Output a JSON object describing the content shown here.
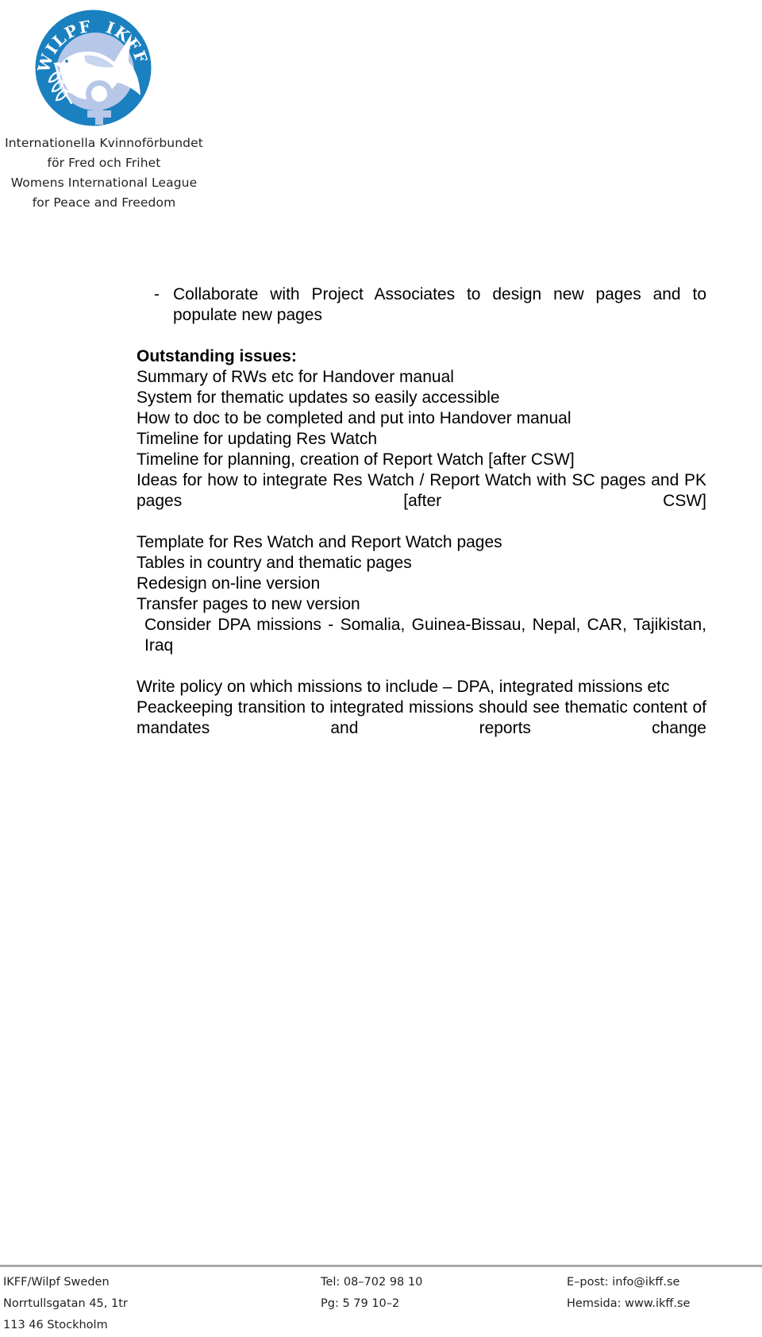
{
  "letterhead": {
    "logo": {
      "icon": "wilpf-ikff-dove-logo",
      "arc_text_left": "WILPF",
      "arc_text_right": "IKFF",
      "circle_color": "#1a80bf",
      "dove_color": "#ffffff",
      "accent_color": "#b7c7e8"
    },
    "org_lines": [
      "Internationella Kvinnoförbundet",
      "för Fred och Frihet",
      "Womens International League",
      "for Peace and Freedom"
    ]
  },
  "body": {
    "bullet": {
      "marker": "-",
      "text": "Collaborate with Project Associates to design new pages and to populate new pages"
    },
    "heading": "Outstanding issues:",
    "issues": [
      "Summary of RWs etc for Handover manual",
      "System for thematic updates so easily accessible",
      "How to doc to be completed and put into Handover manual",
      "Timeline for updating Res Watch",
      "Timeline for planning, creation of Report Watch [after CSW]",
      "Ideas for how to integrate Res Watch / Report Watch with SC pages and PK pages [after CSW]",
      "Template for Res Watch and Report Watch pages",
      "Tables in country and thematic pages",
      "Redesign on-line version",
      "Transfer pages to new version",
      "Consider DPA missions - Somalia, Guinea-Bissau, Nepal, CAR, Tajikistan, Iraq"
    ],
    "paragraphs": [
      "Write policy on which missions to include – DPA, integrated missions etc",
      "Peackeeping transition to integrated missions should see thematic content of mandates and reports change"
    ]
  },
  "footer": {
    "column1": [
      "IKFF/Wilpf Sweden",
      "Norrtullsgatan 45, 1tr",
      "113 46 Stockholm"
    ],
    "column2": [
      "Tel: 08–702 98 10",
      "Pg: 5 79 10–2"
    ],
    "column3": [
      "E–post: info@ikff.se",
      "Hemsida: www.ikff.se"
    ]
  }
}
